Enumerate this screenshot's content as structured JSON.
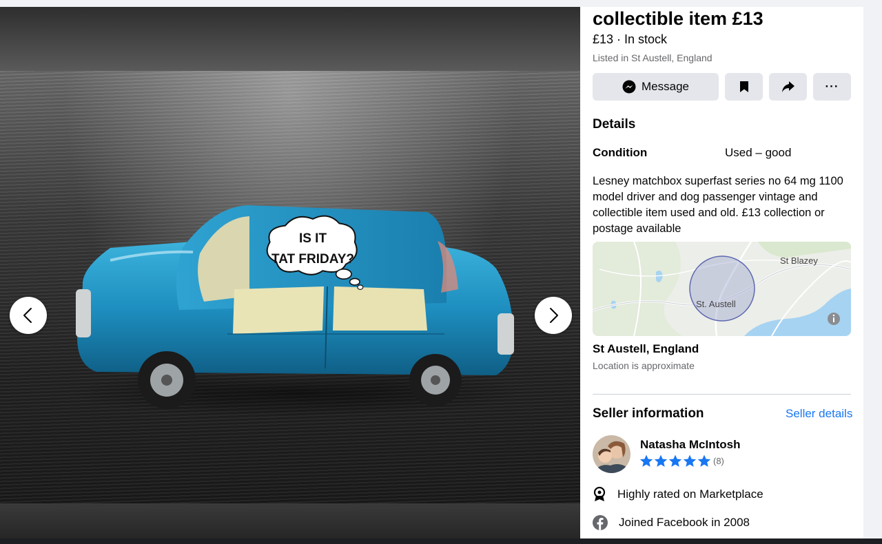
{
  "viewer": {
    "bubble_text_line1": "IS IT",
    "bubble_text_line2": "TAT FRIDAY?",
    "prev_icon": "chevron-left-icon",
    "next_icon": "chevron-right-icon"
  },
  "listing": {
    "title": "collectible item £13",
    "price_line": "£13 · In stock",
    "listed_in": "Listed in St Austell, England"
  },
  "actions": {
    "message_label": "Message",
    "message_icon": "messenger-icon",
    "save_icon": "bookmark-icon",
    "share_icon": "share-icon",
    "more_label": "···"
  },
  "details": {
    "heading": "Details",
    "condition_label": "Condition",
    "condition_value": "Used – good",
    "description": "Lesney matchbox superfast series no 64 mg 1100 model driver and dog passenger vintage and collectible item used and old. £13 collection or postage available"
  },
  "map": {
    "label_main": "St. Austell",
    "label_secondary": "St Blazey",
    "info_icon": "info-icon"
  },
  "location": {
    "name": "St Austell, England",
    "note": "Location is approximate"
  },
  "seller": {
    "heading": "Seller information",
    "details_link": "Seller details",
    "name": "Natasha McIntosh",
    "stars": 5,
    "rating_count": "(8)",
    "highly_rated": "Highly rated on Marketplace",
    "joined": "Joined Facebook in 2008"
  },
  "colors": {
    "accent": "#1877f2",
    "button_bg": "#e4e6eb",
    "car_blue": "#1e8fc0",
    "secondary_text": "#65676b"
  }
}
